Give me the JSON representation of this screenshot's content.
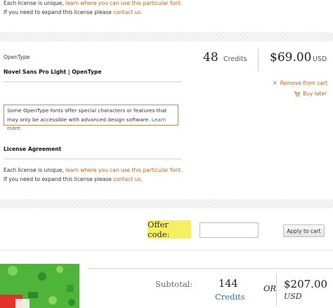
{
  "top_license": {
    "line1_prefix": "Each license is unique,",
    "line1_link": "learn where you can use this particular font.",
    "line2_prefix": "If you need to expand this license please",
    "line2_link": "contact us."
  },
  "item": {
    "format": "OpenType",
    "name": "Novel Sans Pro Light | OpenType",
    "credits_value": "48",
    "credits_label": "Credits",
    "price": "$69.00",
    "currency": "USD",
    "remove_label": "Remove from cart",
    "buy_later_label": "Buy later",
    "note_text": "Some OpenType fonts offer special characters or features that may only be accessible with advanced design software.",
    "note_link": "Learn more.",
    "license_heading": "License Agreement",
    "license_line1_prefix": "Each license is unique,",
    "license_line1_link": "learn where you can use this particular font.",
    "license_line2_prefix": "If you need to expand this license please",
    "license_line2_link": "contact us."
  },
  "offer": {
    "label": "Offer code:",
    "input_value": "",
    "input_placeholder": "",
    "apply_label": "Apply to cart"
  },
  "summary": {
    "subtotal_label": "Subtotal:",
    "credits_value": "144",
    "credits_label": "Credits",
    "or_label": "OR",
    "price": "$207.00",
    "currency": "USD"
  },
  "colors": {
    "link": "#c8601a",
    "note_border": "#d78b3b",
    "offer_highlight": "#f5f060",
    "credits_link": "#2a6db5"
  },
  "icons": {
    "remove": "x-icon",
    "buy_later": "cart-icon"
  }
}
